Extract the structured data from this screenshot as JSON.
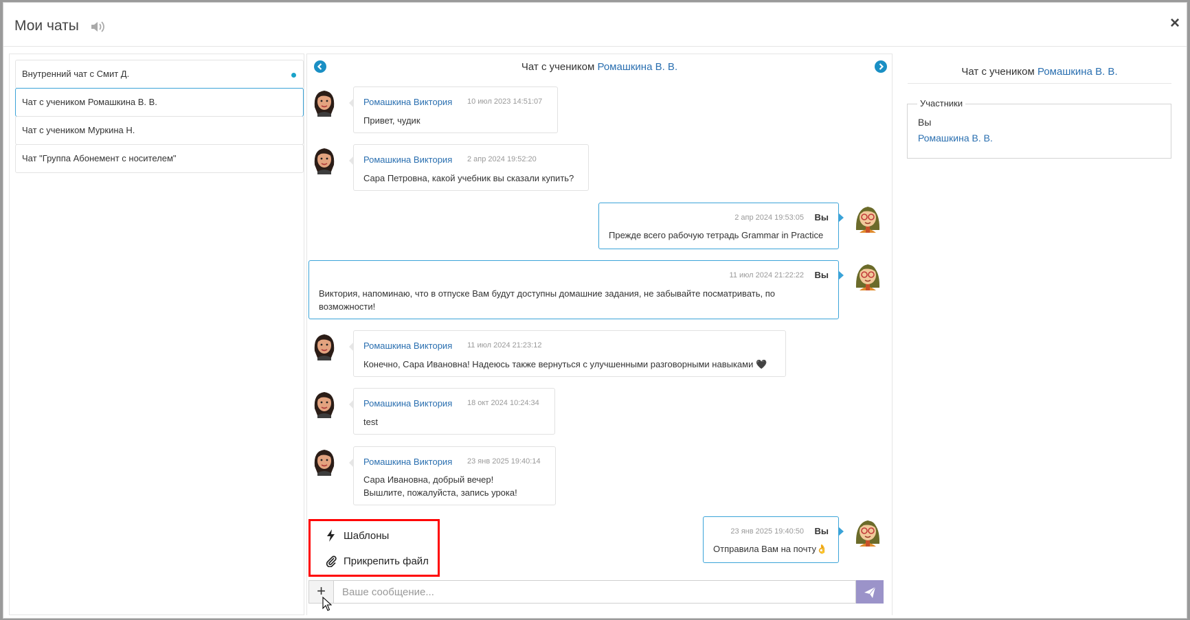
{
  "modal": {
    "title": "Мои чаты",
    "close": "×"
  },
  "chats": [
    {
      "label": "Внутренний чат с Смит Д."
    },
    {
      "label": "Чат с учеником Ромашкина В. В."
    },
    {
      "label": "Чат с учеником Муркина Н."
    },
    {
      "label": "Чат \"Группа Абонемент с носителем\""
    }
  ],
  "conversation": {
    "title_prefix": "Чат с учеником",
    "title_name": "Ромашкина В. В.",
    "messages": [
      {
        "author": "Ромашкина Виктория",
        "time": "10 июл 2023 14:51:07",
        "text": "Привет, чудик"
      },
      {
        "author": "Ромашкина Виктория",
        "time": "2 апр 2024 19:52:20",
        "text": "Сара Петровна, какой учебник вы сказали купить?"
      },
      {
        "author": "Вы",
        "time": "2 апр 2024 19:53:05",
        "text": "Прежде всего рабочую тетрадь Grammar in Practice"
      },
      {
        "author": "Вы",
        "time": "11 июл 2024 21:22:22",
        "text_line1": "Виктория, напоминаю, что в отпуске Вам будут доступны домашние задания, не забывайте посматривать, по",
        "text_line2": "возможности!"
      },
      {
        "author": "Ромашкина Виктория",
        "time": "11 июл 2024 21:23:12",
        "text": "Конечно, Сара Ивановна! Надеюсь также вернуться с улучшенными разговорными навыками 🖤"
      },
      {
        "author": "Ромашкина Виктория",
        "time": "18 окт 2024 10:24:34",
        "text": "test"
      },
      {
        "author": "Ромашкина Виктория",
        "time": "23 янв 2025 19:40:14",
        "text_line1": "Сара Ивановна, добрый вечер!",
        "text_line2": "Вышлите, пожалуйста, запись урока!"
      },
      {
        "author": "Вы",
        "time": "23 янв 2025 19:40:50",
        "text": "Отправила Вам на почту👌"
      }
    ]
  },
  "popup": {
    "templates": "Шаблоны",
    "attach": "Прикрепить файл"
  },
  "composer": {
    "plus": "+",
    "placeholder": "Ваше сообщение..."
  },
  "info": {
    "title_prefix": "Чат с учеником",
    "title_name": "Ромашкина В. В.",
    "legend": "Участники",
    "participants": [
      "Вы",
      "Ромашкина В. В."
    ]
  },
  "colors": {
    "accent": "#3aa3d8",
    "link": "#2a6fb0",
    "send": "#9b93c9",
    "highlight": "#ff0000"
  },
  "icons": {
    "sound": "volume-icon",
    "prev": "chevron-left-icon",
    "next": "chevron-right-icon",
    "templates": "lightning-icon",
    "attach": "paperclip-icon",
    "send": "paper-plane-icon"
  }
}
